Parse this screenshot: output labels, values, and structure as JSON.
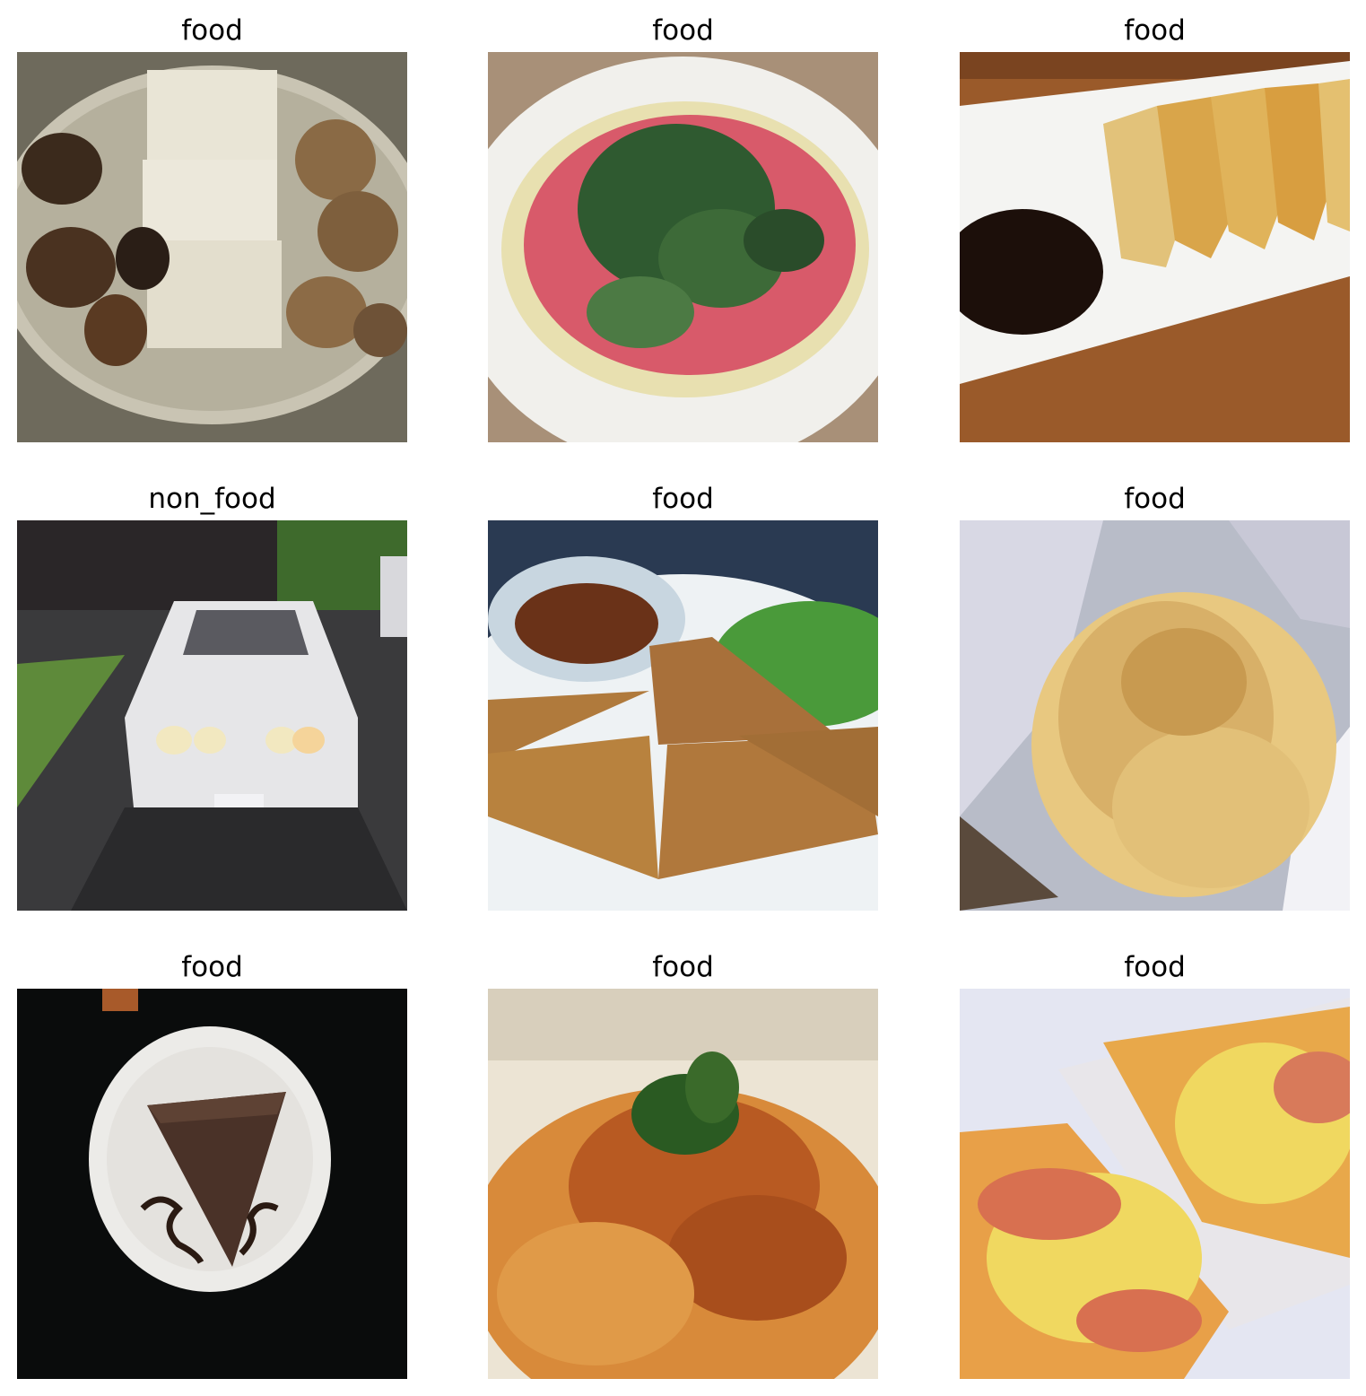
{
  "grid": {
    "images": [
      {
        "label": "food"
      },
      {
        "label": "food"
      },
      {
        "label": "food"
      },
      {
        "label": "non_food"
      },
      {
        "label": "food"
      },
      {
        "label": "food"
      },
      {
        "label": "food"
      },
      {
        "label": "food"
      },
      {
        "label": "food"
      }
    ]
  }
}
